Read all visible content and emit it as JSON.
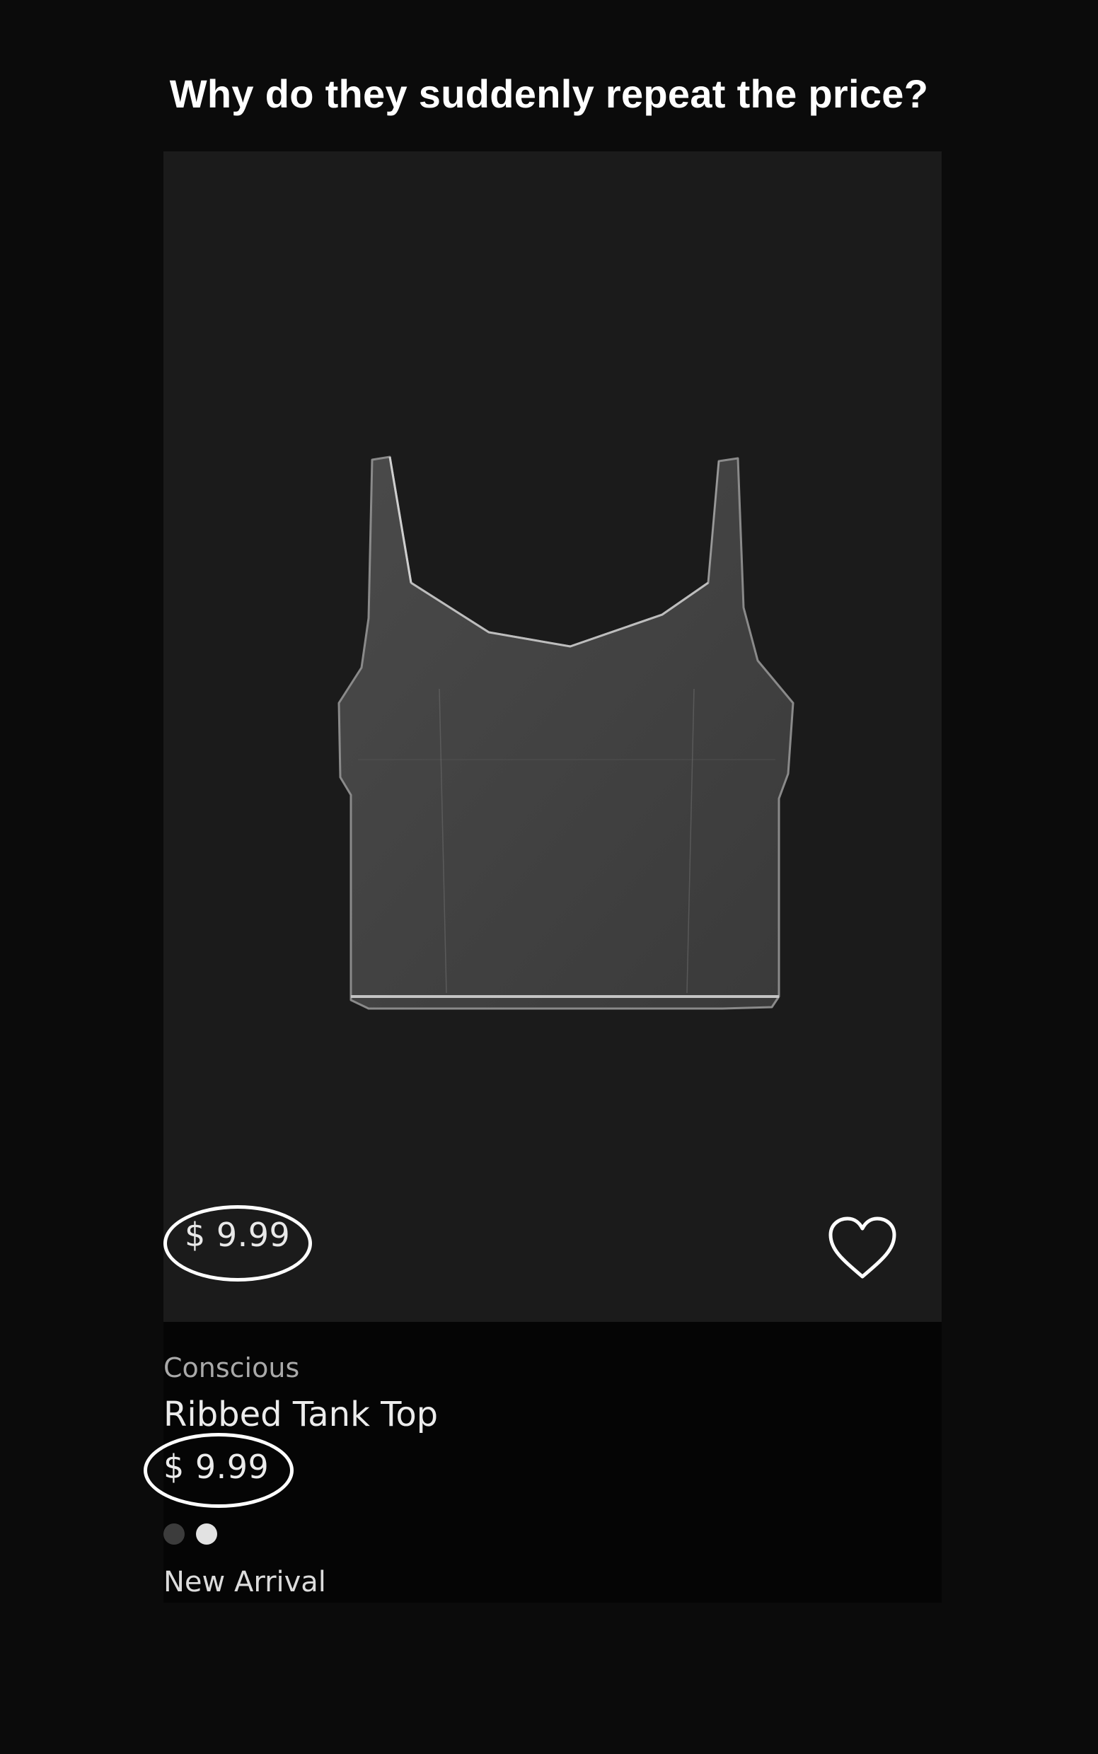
{
  "headline": "Why do they suddenly repeat the price?",
  "product": {
    "image_icon": "tank-top-image",
    "overlay_price": "$ 9.99",
    "brand": "Conscious",
    "title": "Ribbed Tank Top",
    "price": "$ 9.99",
    "badge": "New Arrival",
    "swatches": [
      "#3c3c3c",
      "#e2e2e2"
    ],
    "wishlist_icon": "heart-icon"
  },
  "annotation_color": "#ffffff"
}
